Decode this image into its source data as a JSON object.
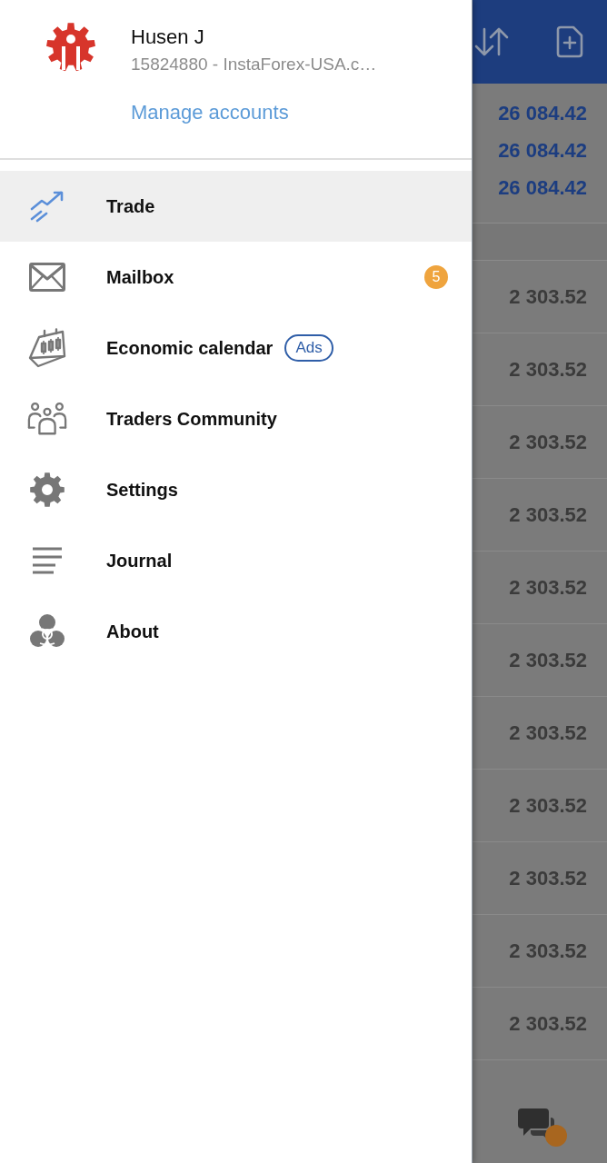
{
  "navigation_drawer": {
    "account": {
      "name": "Husen J",
      "details": "15824880 - InstaForex-USA.c…",
      "link": "Manage accounts"
    },
    "menu_items": [
      {
        "label": "Trade",
        "selected": true
      },
      {
        "label": "Mailbox",
        "selected": false,
        "badge": "5"
      },
      {
        "label": "Economic calendar",
        "selected": false,
        "tag": "Ads"
      },
      {
        "label": "Traders Community",
        "selected": false
      },
      {
        "label": "Settings",
        "selected": false
      },
      {
        "label": "Journal",
        "selected": false
      },
      {
        "label": "About",
        "selected": false
      }
    ]
  },
  "background_screen": {
    "summary_values": [
      "26 084.42",
      "26 084.42",
      "26 084.42"
    ],
    "list_values": [
      "2 303.52",
      "2 303.52",
      "2 303.52",
      "2 303.52",
      "2 303.52",
      "2 303.52",
      "2 303.52",
      "2 303.52",
      "2 303.52",
      "2 303.52",
      "2 303.52"
    ]
  }
}
